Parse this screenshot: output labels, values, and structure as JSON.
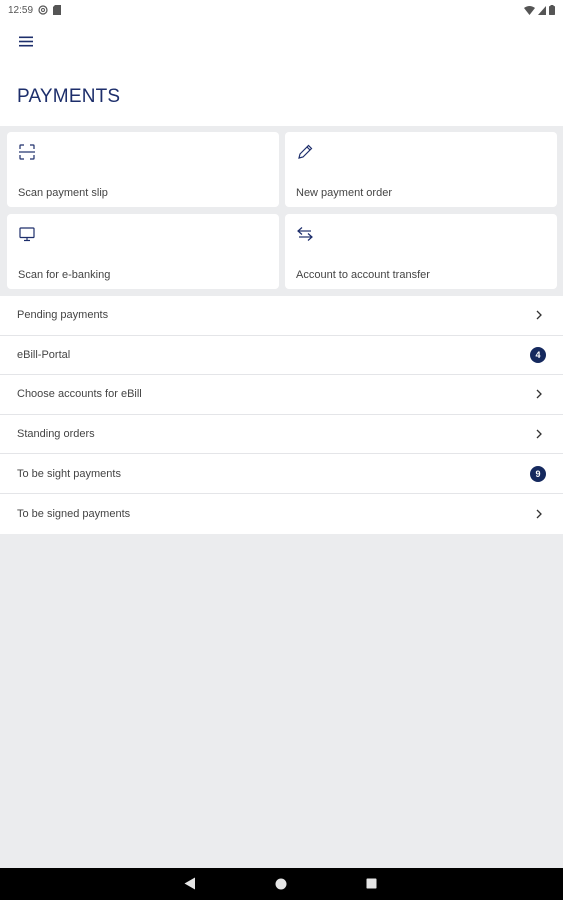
{
  "status_bar": {
    "time": "12:59",
    "icons": [
      "at-icon",
      "sd-card-icon",
      "wifi-icon",
      "signal-icon",
      "battery-icon"
    ]
  },
  "header": {
    "menu_icon": "hamburger-menu-icon",
    "title": "PAYMENTS"
  },
  "tiles": [
    {
      "label": "Scan payment slip",
      "icon": "scan-icon"
    },
    {
      "label": "New payment order",
      "icon": "pencil-icon"
    },
    {
      "label": "Scan for e-banking",
      "icon": "monitor-icon"
    },
    {
      "label": "Account to account transfer",
      "icon": "transfer-arrows-icon"
    }
  ],
  "list": [
    {
      "label": "Pending payments",
      "trailing": "chevron"
    },
    {
      "label": "eBill-Portal",
      "trailing": "badge",
      "badge": "4"
    },
    {
      "label": "Choose accounts for eBill",
      "trailing": "chevron"
    },
    {
      "label": "Standing orders",
      "trailing": "chevron"
    },
    {
      "label": "To be sight payments",
      "trailing": "badge",
      "badge": "9"
    },
    {
      "label": "To be signed payments",
      "trailing": "chevron"
    }
  ],
  "nav_bar": {
    "back_icon": "back-triangle-icon",
    "home_icon": "home-circle-icon",
    "recents_icon": "recents-square-icon"
  },
  "colors": {
    "title": "#1d2e6b",
    "badge": "#15295e",
    "background": "#ebecee"
  }
}
